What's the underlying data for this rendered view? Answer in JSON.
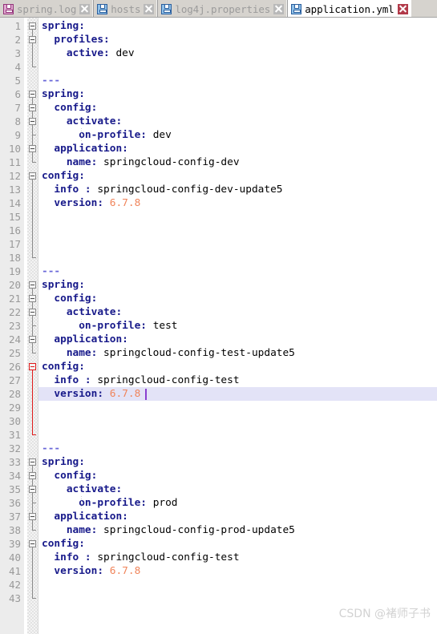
{
  "tabs": [
    {
      "label": "spring.log",
      "icon": "floppy-disk-icon-pink",
      "active": false,
      "close_icon": "close-icon"
    },
    {
      "label": "hosts",
      "icon": "floppy-disk-icon",
      "active": false,
      "close_icon": "close-icon"
    },
    {
      "label": "log4j.properties",
      "icon": "floppy-disk-icon",
      "active": false,
      "close_icon": "close-icon"
    },
    {
      "label": "application.yml",
      "icon": "floppy-disk-icon",
      "active": true,
      "close_icon": "close-icon"
    }
  ],
  "editor": {
    "current_line": 28,
    "caret": {
      "line": 28,
      "column": 16
    },
    "lines": [
      {
        "num": "1",
        "segments": [
          {
            "text": "spring:",
            "type": "key"
          }
        ]
      },
      {
        "num": "2",
        "segments": [
          {
            "text": "  profiles:",
            "type": "key"
          }
        ]
      },
      {
        "num": "3",
        "segments": [
          {
            "text": "    active:",
            "type": "key"
          },
          {
            "text": " dev",
            "type": "value"
          }
        ]
      },
      {
        "num": "4",
        "segments": []
      },
      {
        "num": "5",
        "segments": [
          {
            "text": "---",
            "type": "doc"
          }
        ]
      },
      {
        "num": "6",
        "segments": [
          {
            "text": "spring:",
            "type": "key"
          }
        ]
      },
      {
        "num": "7",
        "segments": [
          {
            "text": "  config:",
            "type": "key"
          }
        ]
      },
      {
        "num": "8",
        "segments": [
          {
            "text": "    activate:",
            "type": "key"
          }
        ]
      },
      {
        "num": "9",
        "segments": [
          {
            "text": "      on-profile:",
            "type": "key"
          },
          {
            "text": " dev",
            "type": "value"
          }
        ]
      },
      {
        "num": "10",
        "segments": [
          {
            "text": "  application:",
            "type": "key"
          }
        ]
      },
      {
        "num": "11",
        "segments": [
          {
            "text": "    name:",
            "type": "key"
          },
          {
            "text": " springcloud-config-dev",
            "type": "value"
          }
        ]
      },
      {
        "num": "12",
        "segments": [
          {
            "text": "config:",
            "type": "key"
          }
        ]
      },
      {
        "num": "13",
        "segments": [
          {
            "text": "  info :",
            "type": "key"
          },
          {
            "text": " springcloud-config-dev-update5",
            "type": "value"
          }
        ]
      },
      {
        "num": "14",
        "segments": [
          {
            "text": "  version:",
            "type": "key"
          },
          {
            "text": " ",
            "type": "value"
          },
          {
            "text": "6.7.8",
            "type": "number"
          }
        ]
      },
      {
        "num": "15",
        "segments": []
      },
      {
        "num": "16",
        "segments": []
      },
      {
        "num": "17",
        "segments": []
      },
      {
        "num": "18",
        "segments": []
      },
      {
        "num": "19",
        "segments": [
          {
            "text": "---",
            "type": "doc"
          }
        ]
      },
      {
        "num": "20",
        "segments": [
          {
            "text": "spring:",
            "type": "key"
          }
        ]
      },
      {
        "num": "21",
        "segments": [
          {
            "text": "  config:",
            "type": "key"
          }
        ]
      },
      {
        "num": "22",
        "segments": [
          {
            "text": "    activate:",
            "type": "key"
          }
        ]
      },
      {
        "num": "23",
        "segments": [
          {
            "text": "      on-profile:",
            "type": "key"
          },
          {
            "text": " test",
            "type": "value"
          }
        ]
      },
      {
        "num": "24",
        "segments": [
          {
            "text": "  application:",
            "type": "key"
          }
        ]
      },
      {
        "num": "25",
        "segments": [
          {
            "text": "    name:",
            "type": "key"
          },
          {
            "text": " springcloud-config-test-update5",
            "type": "value"
          }
        ]
      },
      {
        "num": "26",
        "segments": [
          {
            "text": "config:",
            "type": "key"
          }
        ]
      },
      {
        "num": "27",
        "segments": [
          {
            "text": "  info :",
            "type": "key"
          },
          {
            "text": " springcloud-config-test",
            "type": "value"
          }
        ]
      },
      {
        "num": "28",
        "segments": [
          {
            "text": "  version:",
            "type": "key"
          },
          {
            "text": " ",
            "type": "value"
          },
          {
            "text": "6.7.8",
            "type": "number"
          }
        ]
      },
      {
        "num": "29",
        "segments": []
      },
      {
        "num": "30",
        "segments": []
      },
      {
        "num": "31",
        "segments": []
      },
      {
        "num": "32",
        "segments": [
          {
            "text": "---",
            "type": "doc"
          }
        ]
      },
      {
        "num": "33",
        "segments": [
          {
            "text": "spring:",
            "type": "key"
          }
        ]
      },
      {
        "num": "34",
        "segments": [
          {
            "text": "  config:",
            "type": "key"
          }
        ]
      },
      {
        "num": "35",
        "segments": [
          {
            "text": "    activate:",
            "type": "key"
          }
        ]
      },
      {
        "num": "36",
        "segments": [
          {
            "text": "      on-profile:",
            "type": "key"
          },
          {
            "text": " prod",
            "type": "value"
          }
        ]
      },
      {
        "num": "37",
        "segments": [
          {
            "text": "  application:",
            "type": "key"
          }
        ]
      },
      {
        "num": "38",
        "segments": [
          {
            "text": "    name:",
            "type": "key"
          },
          {
            "text": " springcloud-config-prod-update5",
            "type": "value"
          }
        ]
      },
      {
        "num": "39",
        "segments": [
          {
            "text": "config:",
            "type": "key"
          }
        ]
      },
      {
        "num": "40",
        "segments": [
          {
            "text": "  info :",
            "type": "key"
          },
          {
            "text": " springcloud-config-test",
            "type": "value"
          }
        ]
      },
      {
        "num": "41",
        "segments": [
          {
            "text": "  version:",
            "type": "key"
          },
          {
            "text": " ",
            "type": "value"
          },
          {
            "text": "6.7.8",
            "type": "number"
          }
        ]
      },
      {
        "num": "42",
        "segments": []
      },
      {
        "num": "43",
        "segments": []
      }
    ],
    "folds": [
      {
        "start": 1,
        "end": 4,
        "color": "gray"
      },
      {
        "start": 2,
        "end": 4,
        "color": "gray"
      },
      {
        "start": 6,
        "end": 11,
        "color": "gray"
      },
      {
        "start": 7,
        "end": 11,
        "color": "gray"
      },
      {
        "start": 8,
        "end": 9,
        "color": "gray"
      },
      {
        "start": 10,
        "end": 11,
        "color": "gray"
      },
      {
        "start": 12,
        "end": 18,
        "color": "gray"
      },
      {
        "start": 20,
        "end": 25,
        "color": "gray"
      },
      {
        "start": 21,
        "end": 25,
        "color": "gray"
      },
      {
        "start": 22,
        "end": 23,
        "color": "gray"
      },
      {
        "start": 24,
        "end": 25,
        "color": "gray"
      },
      {
        "start": 26,
        "end": 31,
        "color": "red"
      },
      {
        "start": 33,
        "end": 38,
        "color": "gray"
      },
      {
        "start": 34,
        "end": 38,
        "color": "gray"
      },
      {
        "start": 35,
        "end": 36,
        "color": "gray"
      },
      {
        "start": 37,
        "end": 38,
        "color": "gray"
      },
      {
        "start": 39,
        "end": 43,
        "color": "gray"
      }
    ],
    "indent_guides": [
      {
        "start": 9,
        "end": 9,
        "level": 3
      },
      {
        "start": 23,
        "end": 23,
        "level": 3
      },
      {
        "start": 36,
        "end": 36,
        "level": 3
      }
    ]
  },
  "watermark": "CSDN @褚师子书",
  "colors": {
    "key": "#17198a",
    "value": "#000000",
    "number": "#f0845a",
    "doc_separator": "#6a68d8",
    "current_line_bg": "#e3e3f7",
    "caret": "#8a3fd0",
    "fold_active": "#e01b1b",
    "gutter_bg": "#ececec",
    "tab_bar_bg": "#d6d3ce"
  }
}
